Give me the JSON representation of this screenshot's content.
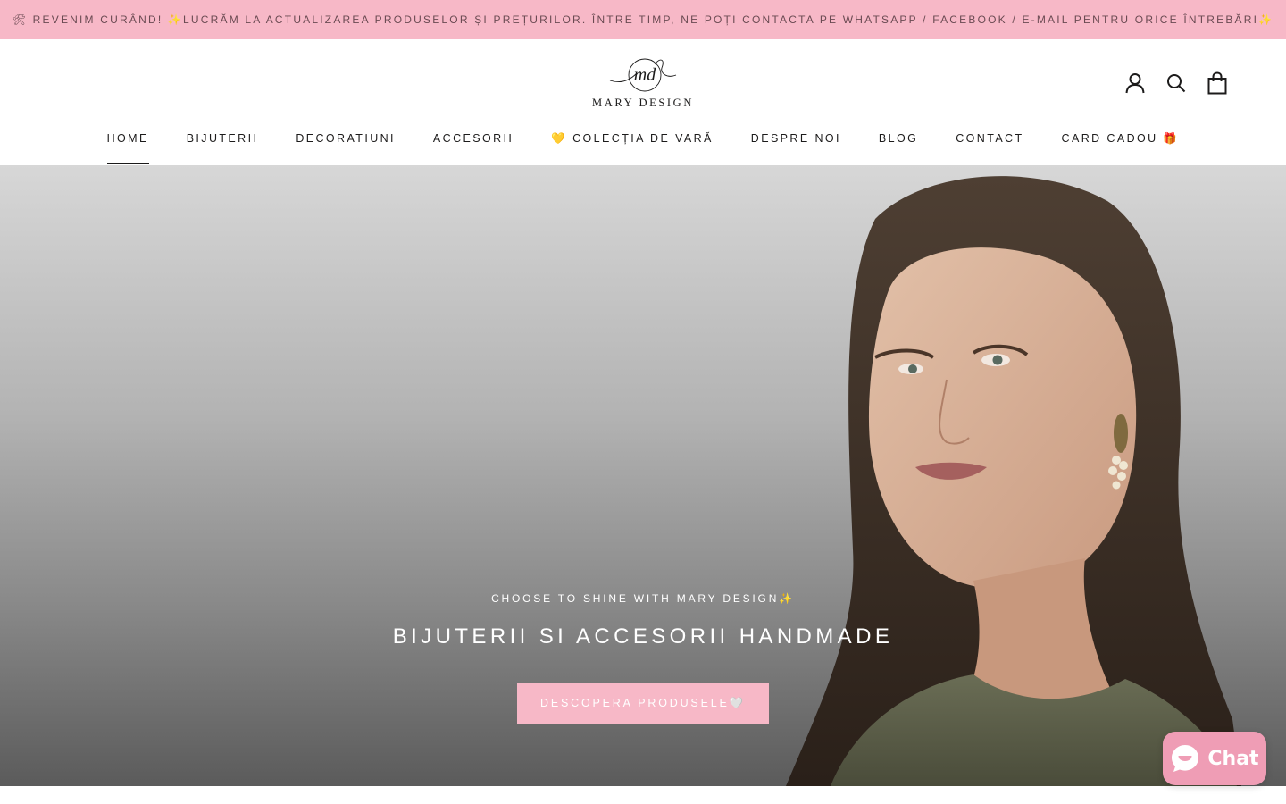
{
  "announcement": {
    "text": "🛠 REVENIM CURÂND! ✨LUCRĂM LA ACTUALIZAREA PRODUSELOR ȘI PREȚURILOR. ÎNTRE TIMP, NE POȚI CONTACTA PE WHATSAPP / FACEBOOK / E-MAIL PENTRU ORICE ÎNTREBĂRI✨",
    "background": "#f7b8c7"
  },
  "header": {
    "logo_monogram": "md",
    "logo_text": "MARY DESIGN",
    "icons": [
      "account-icon",
      "search-icon",
      "cart-icon"
    ]
  },
  "nav": {
    "items": [
      {
        "label": "HOME",
        "active": true
      },
      {
        "label": "BIJUTERII",
        "active": false
      },
      {
        "label": "DECORATIUNI",
        "active": false
      },
      {
        "label": "ACCESORII",
        "active": false
      },
      {
        "label": "💛 COLECȚIA DE VARĂ",
        "active": false
      },
      {
        "label": "DESPRE NOI",
        "active": false
      },
      {
        "label": "BLOG",
        "active": false
      },
      {
        "label": "CONTACT",
        "active": false
      },
      {
        "label": "CARD CADOU 🎁",
        "active": false
      }
    ]
  },
  "hero": {
    "subheading": "CHOOSE TO SHINE WITH MARY DESIGN✨",
    "heading": "BIJUTERII SI ACCESORII HANDMADE",
    "button_label": "DESCOPERA PRODUSELE🤍",
    "accent": "#f7b8c7"
  },
  "chat": {
    "label": "Chat",
    "color": "#ef9db5",
    "icon": "chat-smile-icon"
  }
}
